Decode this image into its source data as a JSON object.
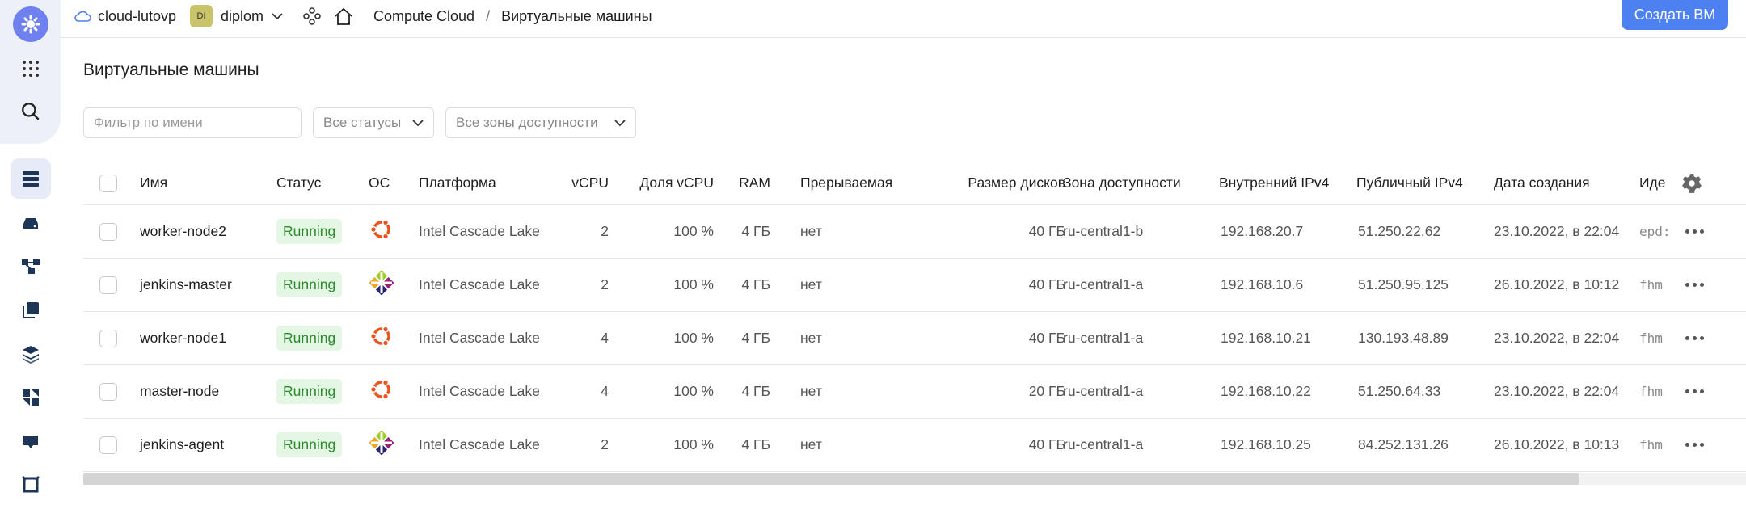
{
  "header": {
    "cloud": "cloud-lutovp",
    "folder_badge": "DI",
    "folder": "diplom",
    "breadcrumb_service": "Compute Cloud",
    "breadcrumb_sep": "/",
    "breadcrumb_page": "Виртуальные машины",
    "create_button": "Создать ВМ"
  },
  "page_title": "Виртуальные машины",
  "filters": {
    "name_placeholder": "Фильтр по имени",
    "status": "Все статусы",
    "zone": "Все зоны доступности"
  },
  "columns": {
    "name": "Имя",
    "status": "Статус",
    "os": "ОС",
    "platform": "Платформа",
    "vcpu": "vCPU",
    "vcpu_share": "Доля vCPU",
    "ram": "RAM",
    "preemptible": "Прерываемая",
    "disk": "Размер дисков",
    "zone": "Зона доступности",
    "internal_ip": "Внутренний IPv4",
    "public_ip": "Публичный IPv4",
    "created": "Дата создания",
    "id": "Иде"
  },
  "rows": [
    {
      "name": "worker-node2",
      "status": "Running",
      "os_icon": "ubuntu-icon",
      "platform": "Intel Cascade Lake",
      "vcpu": "2",
      "vcpu_share": "100 %",
      "ram": "4 ГБ",
      "preemptible": "нет",
      "disk": "40 ГБ",
      "zone": "ru-central1-b",
      "internal_ip": "192.168.20.7",
      "public_ip": "51.250.22.62",
      "created": "23.10.2022, в 22:04",
      "id": "epd:"
    },
    {
      "name": "jenkins-master",
      "status": "Running",
      "os_icon": "centos-icon",
      "platform": "Intel Cascade Lake",
      "vcpu": "2",
      "vcpu_share": "100 %",
      "ram": "4 ГБ",
      "preemptible": "нет",
      "disk": "40 ГБ",
      "zone": "ru-central1-a",
      "internal_ip": "192.168.10.6",
      "public_ip": "51.250.95.125",
      "created": "26.10.2022, в 10:12",
      "id": "fhm"
    },
    {
      "name": "worker-node1",
      "status": "Running",
      "os_icon": "ubuntu-icon",
      "platform": "Intel Cascade Lake",
      "vcpu": "4",
      "vcpu_share": "100 %",
      "ram": "4 ГБ",
      "preemptible": "нет",
      "disk": "40 ГБ",
      "zone": "ru-central1-a",
      "internal_ip": "192.168.10.21",
      "public_ip": "130.193.48.89",
      "created": "23.10.2022, в 22:04",
      "id": "fhm"
    },
    {
      "name": "master-node",
      "status": "Running",
      "os_icon": "ubuntu-icon",
      "platform": "Intel Cascade Lake",
      "vcpu": "4",
      "vcpu_share": "100 %",
      "ram": "4 ГБ",
      "preemptible": "нет",
      "disk": "20 ГБ",
      "zone": "ru-central1-a",
      "internal_ip": "192.168.10.22",
      "public_ip": "51.250.64.33",
      "created": "23.10.2022, в 22:04",
      "id": "fhm"
    },
    {
      "name": "jenkins-agent",
      "status": "Running",
      "os_icon": "centos-icon",
      "platform": "Intel Cascade Lake",
      "vcpu": "2",
      "vcpu_share": "100 %",
      "ram": "4 ГБ",
      "preemptible": "нет",
      "disk": "40 ГБ",
      "zone": "ru-central1-a",
      "internal_ip": "192.168.10.25",
      "public_ip": "84.252.131.26",
      "created": "26.10.2022, в 10:13",
      "id": "fhm"
    }
  ],
  "colors": {
    "accent": "#4d80f0",
    "status_bg": "#e4f6e4",
    "status_text": "#2c8a2c",
    "ubuntu": "#e95420"
  }
}
